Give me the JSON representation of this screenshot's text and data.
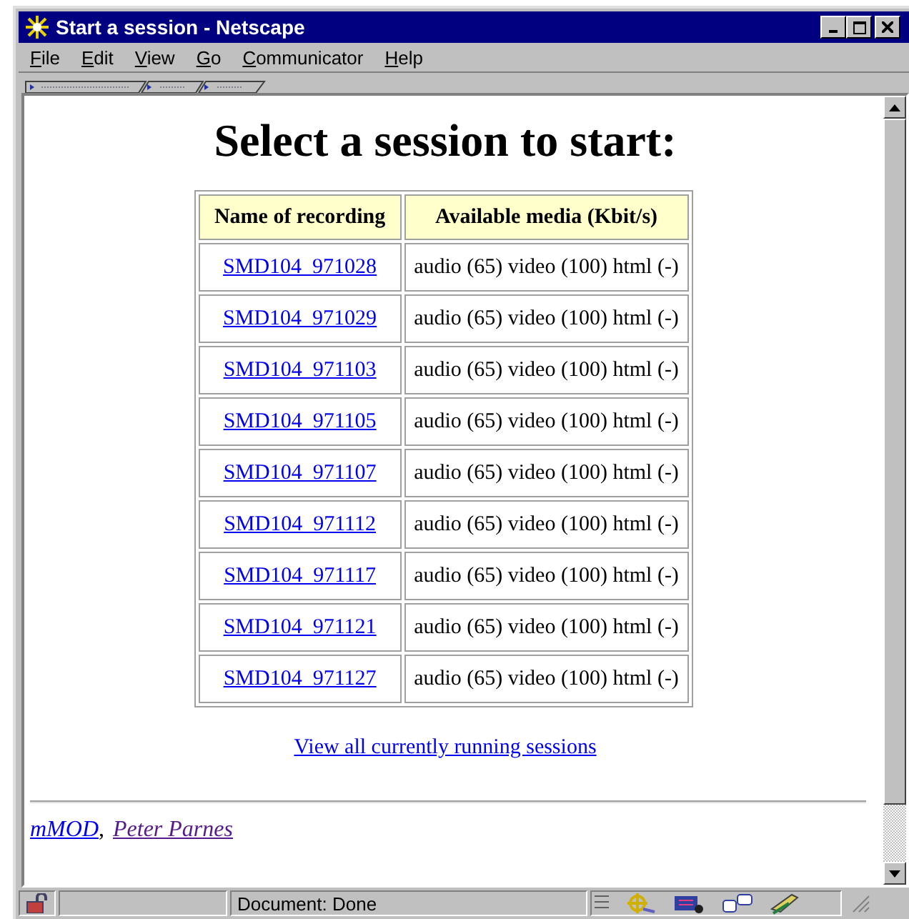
{
  "window": {
    "title": "Start a session - Netscape"
  },
  "menu": [
    "File",
    "Edit",
    "View",
    "Go",
    "Communicator",
    "Help"
  ],
  "heading": "Select a session to start:",
  "table": {
    "columns": [
      "Name of recording",
      "Available media (Kbit/s)"
    ],
    "rows": [
      {
        "name": "SMD104_971028",
        "media": "audio (65) video (100) html (-)"
      },
      {
        "name": "SMD104_971029",
        "media": "audio (65) video (100) html (-)"
      },
      {
        "name": "SMD104_971103",
        "media": "audio (65) video (100) html (-)"
      },
      {
        "name": "SMD104_971105",
        "media": "audio (65) video (100) html (-)"
      },
      {
        "name": "SMD104_971107",
        "media": "audio (65) video (100) html (-)"
      },
      {
        "name": "SMD104_971112",
        "media": "audio (65) video (100) html (-)"
      },
      {
        "name": "SMD104_971117",
        "media": "audio (65) video (100) html (-)"
      },
      {
        "name": "SMD104_971121",
        "media": "audio (65) video (100) html (-)"
      },
      {
        "name": "SMD104_971127",
        "media": "audio (65) video (100) html (-)"
      }
    ]
  },
  "running_link": "View all currently running sessions",
  "footer_separator": ",",
  "footer_links": [
    {
      "text": "mMOD",
      "visited": false
    },
    {
      "text": "Peter Parnes",
      "visited": true
    }
  ],
  "status_bar": {
    "text": "Document: Done"
  }
}
